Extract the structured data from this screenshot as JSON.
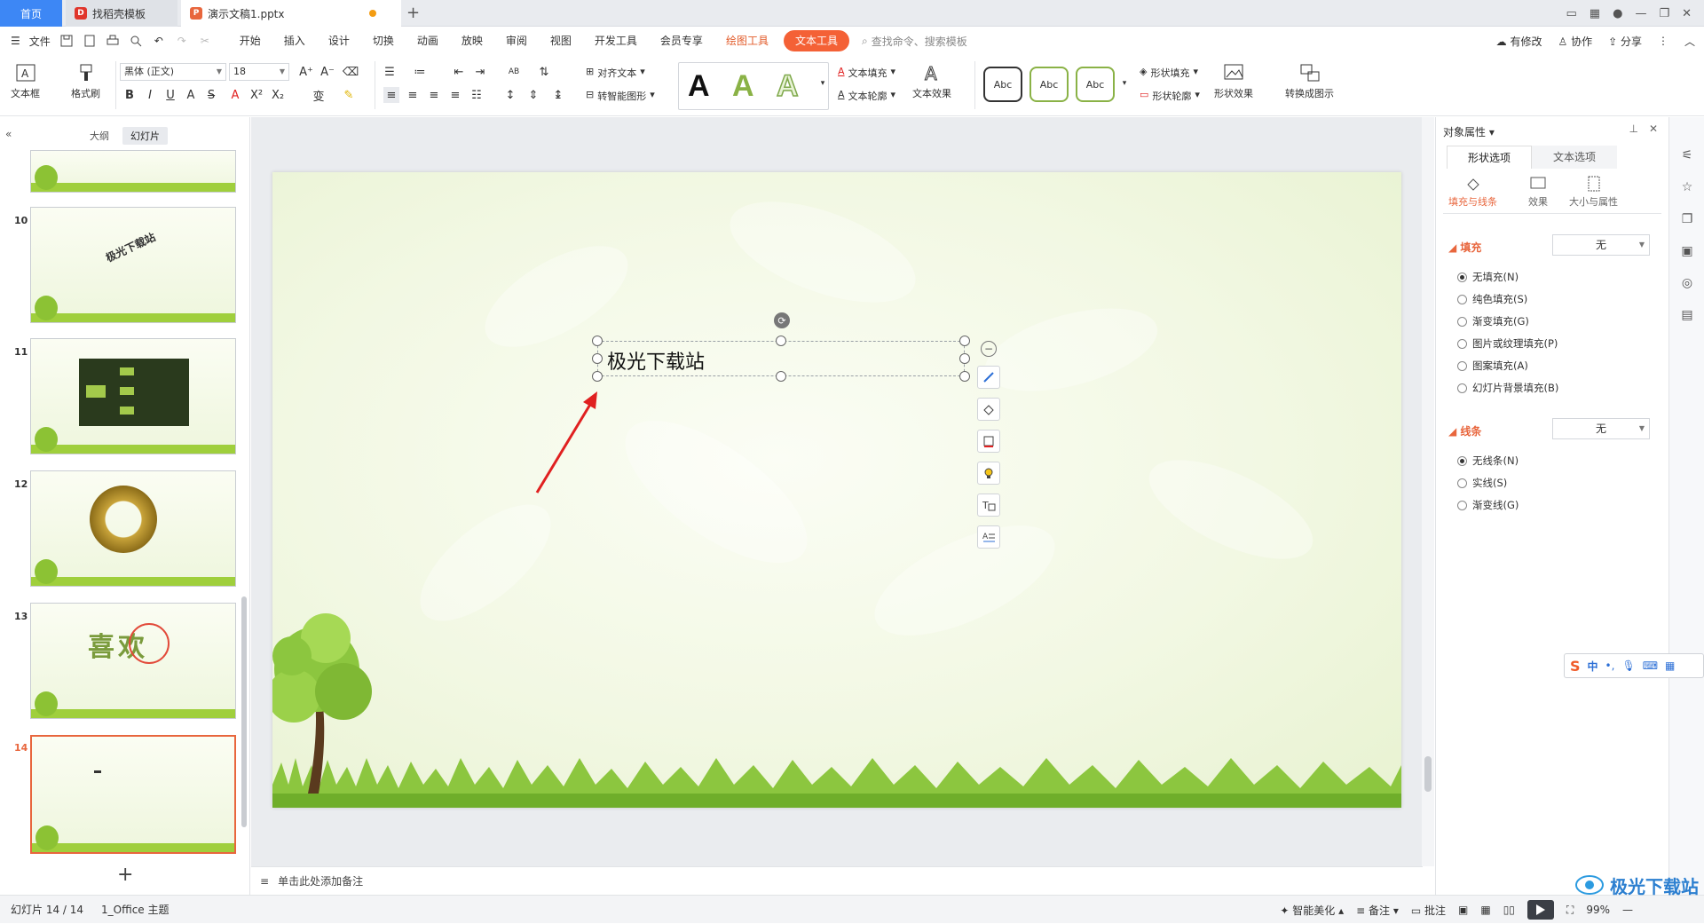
{
  "tabs": {
    "home": "首页",
    "template": "找稻壳模板",
    "doc": "演示文稿1.pptx"
  },
  "menu": {
    "file": "文件",
    "items": [
      "开始",
      "插入",
      "设计",
      "切换",
      "动画",
      "放映",
      "审阅",
      "视图",
      "开发工具",
      "会员专享"
    ],
    "draw_tool": "绘图工具",
    "text_tool": "文本工具",
    "search_placeholder": "查找命令、搜索模板",
    "right": {
      "modified": "有修改",
      "collab": "协作",
      "share": "分享"
    }
  },
  "ribbon": {
    "textbox": "文本框",
    "format_painter": "格式刷",
    "font_name": "黑体 (正文)",
    "font_size": "18",
    "align_text": "对齐文本",
    "smart_shape": "转智能图形",
    "text_fill": "文本填充",
    "text_outline": "文本轮廓",
    "text_effect": "文本效果",
    "abc": "Abc",
    "shape_fill": "形状填充",
    "shape_outline": "形状轮廓",
    "shape_effect": "形状效果",
    "convert_image": "转换成图示",
    "big_a": "A",
    "ab_label": "AB"
  },
  "left_panel": {
    "tab_outline": "大纲",
    "tab_slides": "幻灯片",
    "slides": [
      {
        "num": "10"
      },
      {
        "num": "11"
      },
      {
        "num": "12"
      },
      {
        "num": "13"
      },
      {
        "num": "14"
      }
    ],
    "slide10_text": "极光下载站",
    "slide13_text": "喜欢"
  },
  "slide": {
    "text": "极光下载站"
  },
  "notes": {
    "placeholder": "单击此处添加备注"
  },
  "right_panel": {
    "title": "对象属性",
    "tab_shape": "形状选项",
    "tab_text": "文本选项",
    "sub_fill_line": "填充与线条",
    "sub_effect": "效果",
    "sub_size": "大小与属性",
    "fill_title": "填充",
    "fill_value": "无",
    "fill_options": [
      "无填充(N)",
      "纯色填充(S)",
      "渐变填充(G)",
      "图片或纹理填充(P)",
      "图案填充(A)",
      "幻灯片背景填充(B)"
    ],
    "line_title": "线条",
    "line_value": "无",
    "line_options": [
      "无线条(N)",
      "实线(S)",
      "渐变线(G)"
    ]
  },
  "ime": {
    "lang": "中"
  },
  "status": {
    "slide_counter": "幻灯片 14 / 14",
    "theme": "1_Office 主题",
    "smart_beautify": "智能美化",
    "notes": "备注",
    "comments": "批注",
    "zoom": "99%"
  },
  "watermark": "极光下载站",
  "colors": {
    "accent": "#e8663d",
    "home_tab": "#3d87f5",
    "text_tool": "#f46136",
    "arrow": "#e02020"
  }
}
